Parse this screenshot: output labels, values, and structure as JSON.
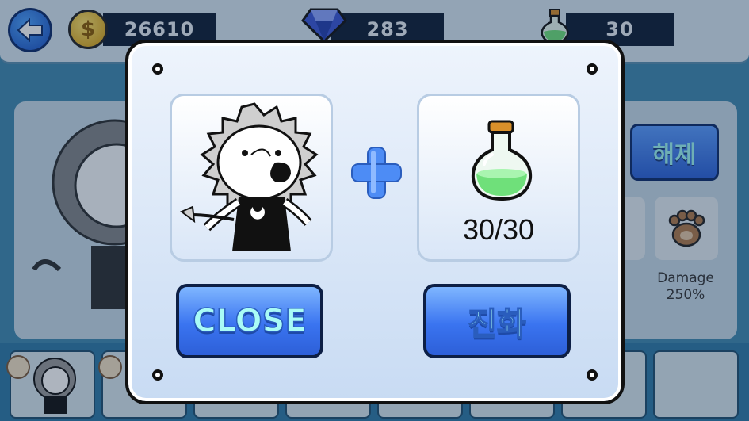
{
  "hud": {
    "gold": "26610",
    "gems": "283",
    "potions": "30",
    "icons": [
      "back-arrow-icon",
      "coin-icon",
      "gem-icon",
      "potion-icon"
    ]
  },
  "panel": {
    "unlock_label": "해제",
    "stat_label": "Damage",
    "stat_value": "250%"
  },
  "dialog": {
    "potion_count": "30/30",
    "close_label": "CLOSE",
    "evolve_label": "진화"
  },
  "colors": {
    "button_blue": "#3a74f0",
    "button_text": "#a9fbf6",
    "potion_liquid": "#6fe07a"
  }
}
